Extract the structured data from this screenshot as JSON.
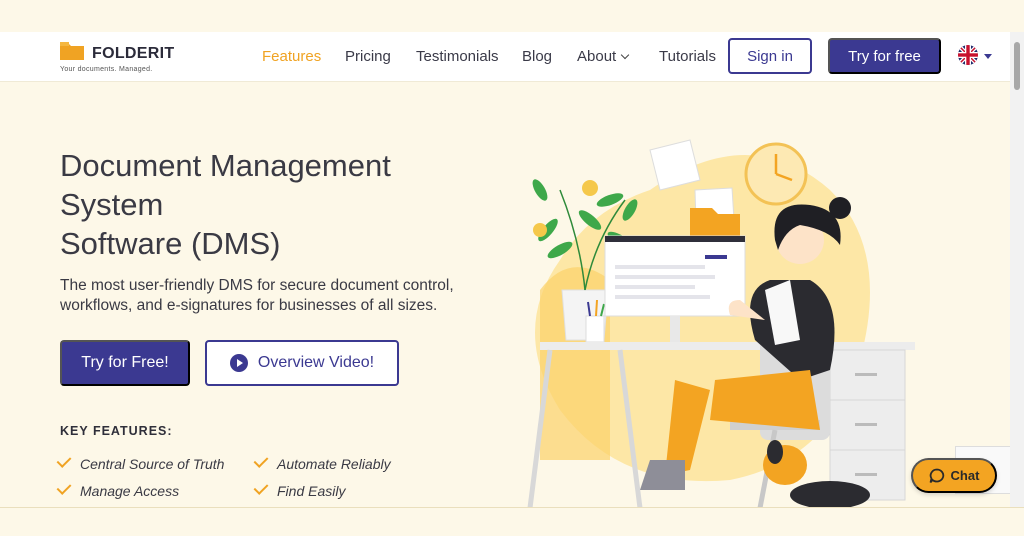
{
  "brand": {
    "name": "FOLDERIT",
    "tagline": "Your documents. Managed.",
    "accent_color": "#f0a323",
    "primary_color": "#3b3991"
  },
  "nav": {
    "items": [
      {
        "label": "Features",
        "active": true
      },
      {
        "label": "Pricing"
      },
      {
        "label": "Testimonials"
      },
      {
        "label": "Blog"
      },
      {
        "label": "About"
      },
      {
        "label": "Tutorials"
      }
    ],
    "sign_in": "Sign in",
    "try_free": "Try for free",
    "language_icon": "uk-flag-icon"
  },
  "hero": {
    "title_lines": [
      "Document Management",
      "System",
      "Software (DMS)"
    ],
    "subtitle": "The most user-friendly DMS for secure document control, workflows, and e-signatures for businesses of all sizes.",
    "cta_primary": "Try for Free!",
    "cta_secondary": "Overview Video!"
  },
  "key_features": {
    "heading": "KEY FEATURES:",
    "items": [
      "Central Source of Truth",
      "Automate Reliably",
      "Manage Access",
      "Find Easily"
    ]
  },
  "chat": {
    "label": "Chat"
  }
}
